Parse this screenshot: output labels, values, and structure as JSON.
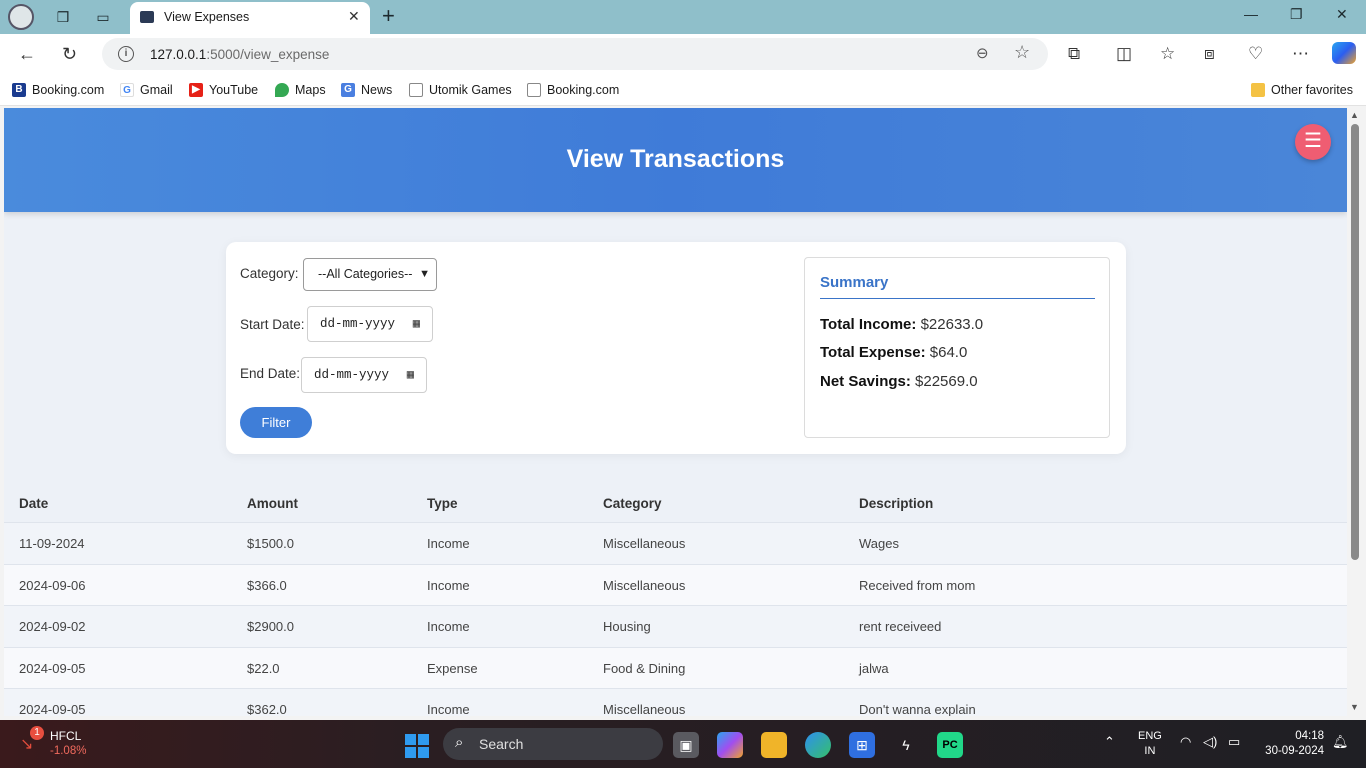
{
  "browser": {
    "tab_title": "View Expenses",
    "url_host": "127.0.0.1",
    "url_path": ":5000/view_expense",
    "favorites": [
      "Booking.com",
      "Gmail",
      "YouTube",
      "Maps",
      "News",
      "Utomik Games",
      "Booking.com"
    ],
    "other_favorites": "Other favorites"
  },
  "page": {
    "title": "View Transactions",
    "filters": {
      "category_label": "Category:",
      "category_value": "--All Categories--",
      "start_label": "Start Date:",
      "start_placeholder": "dd-mm-yyyy",
      "end_label": "End Date:",
      "end_placeholder": "dd-mm-yyyy",
      "button": "Filter"
    },
    "summary": {
      "title": "Summary",
      "income_label": "Total Income:",
      "income_value": "$22633.0",
      "expense_label": "Total Expense:",
      "expense_value": "$64.0",
      "savings_label": "Net Savings:",
      "savings_value": "$22569.0"
    },
    "table": {
      "headers": [
        "Date",
        "Amount",
        "Type",
        "Category",
        "Description"
      ],
      "rows": [
        [
          "11-09-2024",
          "$1500.0",
          "Income",
          "Miscellaneous",
          "Wages"
        ],
        [
          "2024-09-06",
          "$366.0",
          "Income",
          "Miscellaneous",
          "Received from mom"
        ],
        [
          "2024-09-02",
          "$2900.0",
          "Income",
          "Housing",
          "rent receiveed"
        ],
        [
          "2024-09-05",
          "$22.0",
          "Expense",
          "Food & Dining",
          "jalwa"
        ],
        [
          "2024-09-05",
          "$362.0",
          "Income",
          "Miscellaneous",
          "Don't wanna explain"
        ]
      ]
    }
  },
  "taskbar": {
    "stock_name": "HFCL",
    "stock_change": "-1.08%",
    "stock_badge": "1",
    "search": "Search",
    "lang_1": "ENG",
    "lang_2": "IN",
    "time": "04:18",
    "date": "30-09-2024"
  }
}
